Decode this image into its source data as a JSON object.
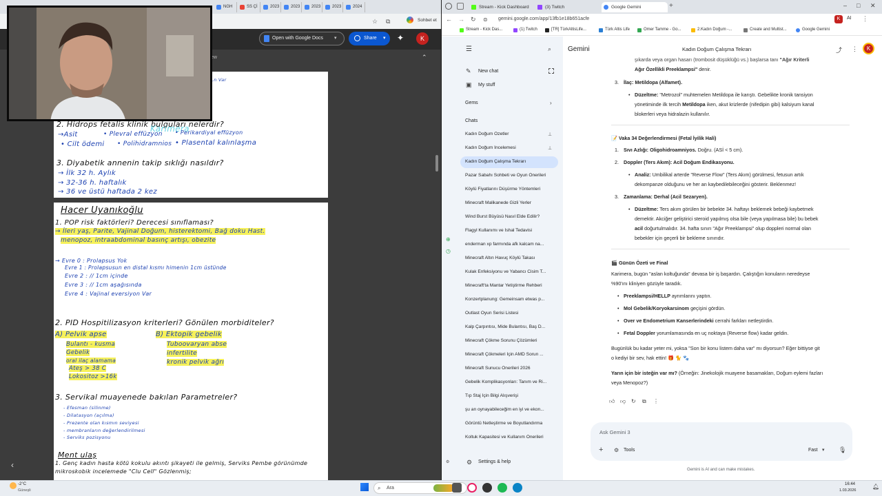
{
  "left_window": {
    "tabs": [
      "NGH",
      "SS Çİ",
      "2023",
      "2023",
      "2023",
      "2023",
      "2024"
    ],
    "top_right_label": "Sohbet et",
    "toolbar": {
      "open_with": "Open with Google Docs",
      "share": "Share",
      "avatar_letter": "K"
    },
    "subbar_caption": "ew",
    "notes": {
      "page1": {
        "top_fragment": "...n Var",
        "q2": "2. Hidrops fetalis klinik bulguları nelerdir?",
        "q2_items": [
          "→Asit",
          "• Plevral effüzyon",
          "• Perikardiyal effüzyon",
          "• Cilt ödemi",
          "• Polihidramnios",
          "• Plasental kalınlaşma"
        ],
        "watermark": "Karimera",
        "q3": "3. Diyabetik annenin takip sıklığı nasıldır?",
        "q3_items": [
          "→ İlk 32 h.  Aylık",
          "→ 32-36 h.  haftalık",
          "→ 36 ve üstü  haftada 2 kez"
        ]
      },
      "page2": {
        "author": "Hacer Uyanıkoğlu",
        "q1": "1. POP risk faktörleri? Derecesi sınıflaması?",
        "q1_line1": "→ İleri yaş, Parite, Vajinal Doğum, histerektomi, Bağ doku Hast.",
        "q1_line2": "menopoz, intraabdominal basınç artışı, obezite",
        "stages": [
          "→ Evre 0 : Prolapsus Yok",
          "Evre 1 : Prolapsusun en distal kısmı himenin 1cm üstünde",
          "Evre 2 :        //                       1cm içinde",
          "Evre 3 :        //                       1cm aşağısında",
          "Evre 4 : Vajinal eversiyon Var"
        ],
        "q2": "2. PID Hospitilizasyon kriterleri? Gönülen morbiditeler?",
        "q2_a_title": "A) Pelvik apse",
        "q2_a": [
          "Bulantı - kusma",
          "Gebelik",
          "oral ilaç alamama",
          "Ateş > 38 C",
          "Lokositoz >16k"
        ],
        "q2_b_title": "B) Ektopik gebelik",
        "q2_b": [
          "Tuboovaryan abse",
          "infertilite",
          "kronik pelvik ağrı"
        ],
        "q3": "3. Servikal muayenede bakılan Parametreler?",
        "q3_items": [
          "- Efesman (silinme)",
          "- Dilatasyon (açılma)",
          "- Prezente olan kısmın seviyesi",
          "- membranların değerlendirilmesi",
          "- Serviks pozisyonu"
        ],
        "vaka_title": "Ment ulaş",
        "vaka_1": "1. Genç kadın hasta kötü kokulu akıntı şikayeti ile gelmiş, Serviks Pembe görünümde",
        "vaka_2": "mikroskobik incelemede \"Clu Cell\" Gözlenmiş;"
      }
    }
  },
  "right_window": {
    "tabs": [
      "Stream - Kick Dashboard",
      "(3) Twitch",
      "Google Gemini"
    ],
    "url": "gemini.google.com/app/13fb1e18b651acfe",
    "profile_letter": "K",
    "ai_label": "AI",
    "bookmarks": [
      "Stream - Kick Das...",
      "(1) Twitch",
      "[TR] TürkAltisLife...",
      "Türk Altis Life",
      "Omer Tamme - Go...",
      "2.Kadın Doğum -...",
      "Create and Multist...",
      "Google Gemini"
    ],
    "app_name": "Gemini",
    "chat_title": "Kadın Doğum Çalışma Tekrarı",
    "sidebar": {
      "new_chat": "New chat",
      "my_stuff": "My stuff",
      "gems": "Gems",
      "chats_header": "Chats",
      "chats": [
        "Kadın Doğum Özetler",
        "Kadın Doğum İncelemesi",
        "Kadın Doğum Çalışma Tekrarı",
        "Pazar Sabahı Sohbeti ve Oyun Önerileri",
        "Köylü Fiyatlarını Düşürme Yöntemleri",
        "Minecraft Malikanede Gizli Yerler",
        "Wind Burst Büyüsü Nasıl Elde Edilir?",
        "Flagyl Kullanımı ve İshal Tedavisi",
        "enderman xp farmında afk kalcam na...",
        "Minecraft Altın Havuç Köylü Takası",
        "Kulak Enfeksiyonu ve Yabancı Cisim T...",
        "Minecraft'ta Mantar Yetiştirme Rehberi",
        "Konzertplanung: Gemeinsam etwas p...",
        "Outlast Oyun Serisi Listesi",
        "Kalp Çarpıntısı, Mide Bulantısı, Baş D...",
        "Minecraft Çökme Sorunu Çözümleri",
        "Minecraft Çökmeleri İçin AMD Sorun ...",
        "Minecraft Sunucu Önerileri 2026",
        "Gebelik Komplikasyonları: Tanım ve Ri...",
        "Tıp Staj İçin Bilgi Alışverişi",
        "şu an oynayabileceğim en iyi ve ekon...",
        "Görüntü Netleştirme ve Boyutlandırma",
        "Koltuk Kapasitesi ve Kullanım Önerileri"
      ],
      "settings": "Settings & help"
    },
    "response": {
      "top_line1_a": "şıkarda veya organ hasarı (trombosit düşüklüğü vs.) başlarsa tanı",
      "top_line1_b": "\"Ağır Kriterli",
      "top_line2": "Ağır Özellikli Preeklampsi\"",
      "top_line2_end": "denir.",
      "item3_num": "3.",
      "item3": "İlaç: Metildopa (Alfamet).",
      "item3_detail_label": "Düzeltme:",
      "item3_detail_a": "\"Metrozol\" muhtemelen Metildopa ile karıştı. Gebelikte kronik tansiyon",
      "item3_detail_b_pre": "yönetiminde ilk tercih",
      "item3_detail_b_bold": "Metildopa",
      "item3_detail_b_post": "iken, akut krizlerde (nifedipin gibi) kalsiyum kanal",
      "item3_detail_c": "blokerleri veya hidralazin kullanılır.",
      "case34_title": "📝 Vaka 34 Değerlendirmesi (Fetal İyilik Hali)",
      "c1_num": "1.",
      "c1_bold": "Sıvı Azlığı: Oligohidroamniyos.",
      "c1_rest": "Doğru. (ASİ < 5 cm).",
      "c2_num": "2.",
      "c2_bold": "Doppler (Ters Akım): Acil Doğum Endikasyonu.",
      "c2_label": "Analiz:",
      "c2_a": "Umbilikal arterde \"Reverse Flow\" (Ters Akım) görülmesi, fetusun artık",
      "c2_b": "dekompanze olduğunu ve her an kaybedilebileceğini gösterir. Beklenmez!",
      "c3_num": "3.",
      "c3_bold": "Zamanlama: Derhal (Acil Sezaryen).",
      "c3_label": "Düzeltme:",
      "c3_a": "Ters akım görülen bir bebekte 34. haftayı beklemek bebeği kaybetmek",
      "c3_b": "demektir. Akciğer geliştirici steroid yapılmış olsa bile (veya yapılmasa bile) bu bebek",
      "c3_c_bold": "acil",
      "c3_c": "doğurtulmalıdır. 34. hafta sınırı \"Ağır Preeklampsi\" olup doppleri normal olan",
      "c3_d": "bebekler için geçerli bir bekleme sınırıdır.",
      "summary_title": "🎬 Günün Özeti ve Final",
      "summary_a": "Karimera, bugün \"aslan koltuğunda\" devasa bir iş başardın. Çalıştığın konuların neredeyse",
      "summary_b": "%90'ını kliniyen gözüyle taradık.",
      "s1_bold": "Preeklampsi/HELLP",
      "s1": "ayrımlarını yaptın.",
      "s2_bold": "Mol Gebelik/Koryokarsinom",
      "s2": "geçişini gördün.",
      "s3_bold": "Over ve Endometrium Kanserlerindeki",
      "s3": "cerrahi farkları netleştirdin.",
      "s4_bold": "Fetal Doppler",
      "s4": "yorumlamasında en uç noktaya (Reverse flow) kadar geldin.",
      "closing_a": "Bugünlük bu kadar yeter mi, yoksa \"Son bir konu listem daha var\" mı diyorsun? Eğer bittiyse git",
      "closing_b": "o kediyi bir sev, hak ettin! 🎁 🐈 🐾",
      "tomorrow_bold": "Yarın için bir isteğin var mı?",
      "tomorrow_a": "(Örneğin: Jinekolojik muayene basamakları, Doğum eylemi fazları",
      "tomorrow_b": "veya Menopoz?)"
    },
    "input": {
      "placeholder": "Ask Gemini 3",
      "tools": "Tools",
      "mode": "Fast"
    },
    "disclaimer": "Gemini is AI and can make mistakes."
  },
  "taskbar": {
    "weather_temp": "-2°C",
    "weather_desc": "Güneşli",
    "search": "Ara",
    "time": "16:44",
    "date": "1.03.2026"
  }
}
